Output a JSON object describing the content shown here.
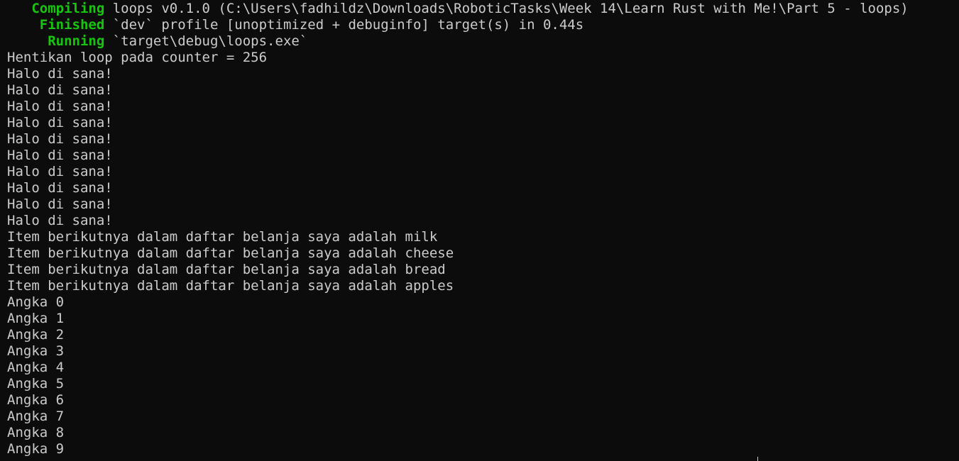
{
  "colors": {
    "background": "#0c0c0c",
    "text": "#cccccc",
    "cargo_status": "#16c60c"
  },
  "cargo": [
    {
      "pad": "   ",
      "status": "Compiling",
      "message": " loops v0.1.0 (C:\\Users\\fadhildz\\Downloads\\RoboticTasks\\Week 14\\Learn Rust with Me!\\Part 5 - loops)"
    },
    {
      "pad": "    ",
      "status": "Finished",
      "message": " `dev` profile [unoptimized + debuginfo] target(s) in 0.44s"
    },
    {
      "pad": "     ",
      "status": "Running",
      "message": " `target\\debug\\loops.exe`"
    }
  ],
  "output": [
    "Hentikan loop pada counter = 256",
    "Halo di sana!",
    "Halo di sana!",
    "Halo di sana!",
    "Halo di sana!",
    "Halo di sana!",
    "Halo di sana!",
    "Halo di sana!",
    "Halo di sana!",
    "Halo di sana!",
    "Halo di sana!",
    "Item berikutnya dalam daftar belanja saya adalah milk",
    "Item berikutnya dalam daftar belanja saya adalah cheese",
    "Item berikutnya dalam daftar belanja saya adalah bread",
    "Item berikutnya dalam daftar belanja saya adalah apples",
    "Angka 0",
    "Angka 1",
    "Angka 2",
    "Angka 3",
    "Angka 4",
    "Angka 5",
    "Angka 6",
    "Angka 7",
    "Angka 8",
    "Angka 9"
  ]
}
